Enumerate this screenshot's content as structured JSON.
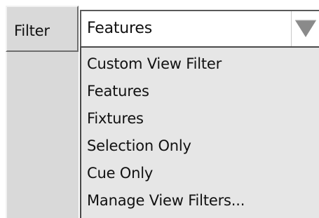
{
  "filter_panel": {
    "label": "Filter"
  },
  "combo": {
    "selected_value": "Features",
    "arrow_icon": "triangle-down-icon"
  },
  "dropdown": {
    "items": [
      {
        "label": "Custom View Filter"
      },
      {
        "label": "Features"
      },
      {
        "label": "Fixtures"
      },
      {
        "label": "Selection Only"
      },
      {
        "label": "Cue Only"
      },
      {
        "label": "Manage View Filters..."
      }
    ]
  },
  "colors": {
    "panel_bg": "#d9d9d9",
    "list_bg": "#e6e6e6",
    "arrow": "#8a8a8a",
    "text": "#111111"
  }
}
